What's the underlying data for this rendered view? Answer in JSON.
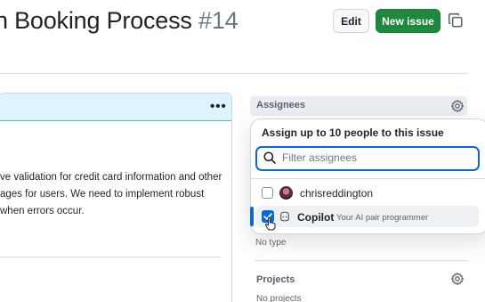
{
  "header": {
    "title_prefix": "n Booking Process",
    "issue_number": "#14",
    "edit_label": "Edit",
    "new_issue_label": "New issue"
  },
  "comment": {
    "lines": [
      "ve validation for credit card information and other",
      "ages for users. We need to implement robust",
      "when errors occur."
    ],
    "menu_glyph": "•••"
  },
  "sidebar": {
    "assignees_label": "Assignees",
    "type_value": "No type",
    "projects_label": "Projects",
    "projects_value": "No projects"
  },
  "assignee_popover": {
    "title": "Assign up to 10 people to this issue",
    "filter_placeholder": "Filter assignees",
    "users": [
      {
        "name": "chrisreddington",
        "checked": false
      },
      {
        "name": "Copilot",
        "subtitle": "Your AI pair programmer",
        "checked": true
      }
    ]
  },
  "colors": {
    "accent_blue": "#0969da",
    "primary_green": "#1f883d",
    "comment_header_bg": "#ddf4ff"
  },
  "icons": [
    "copy-icon",
    "kebab-menu-icon",
    "gear-icon",
    "search-icon",
    "checkbox-icon",
    "check-icon",
    "copilot-icon",
    "pointer-cursor-icon"
  ]
}
